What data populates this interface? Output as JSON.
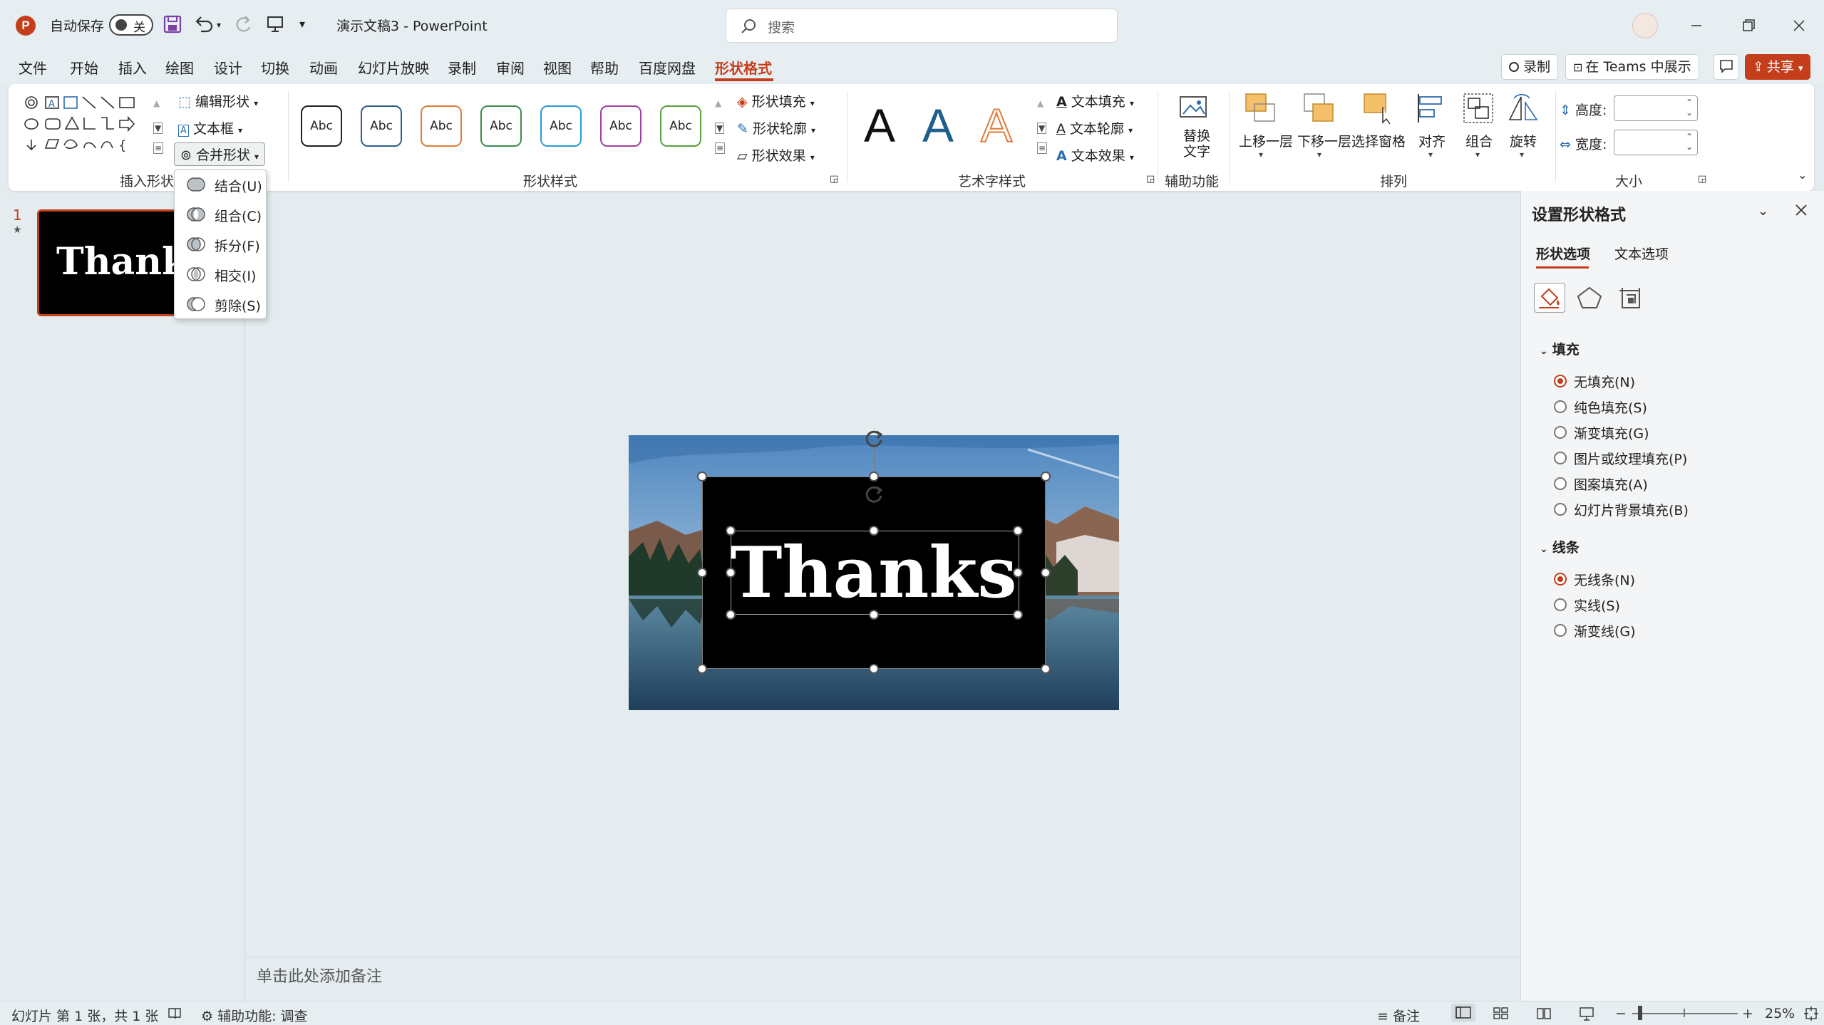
{
  "titlebar": {
    "autosave_label": "自动保存",
    "autosave_state": "关",
    "doc_title": "演示文稿3  -  PowerPoint",
    "search_placeholder": "搜索"
  },
  "menu": {
    "items": [
      "文件",
      "开始",
      "插入",
      "绘图",
      "设计",
      "切换",
      "动画",
      "幻灯片放映",
      "录制",
      "审阅",
      "视图",
      "帮助",
      "百度网盘",
      "形状格式"
    ],
    "active": "形状格式",
    "record_btn": "录制",
    "teams_btn": "在 Teams 中展示",
    "share_btn": "共享"
  },
  "ribbon": {
    "insert_shapes": {
      "label": "插入形状",
      "edit_shape": "编辑形状",
      "text_box": "文本框",
      "merge_shapes": "合并形状"
    },
    "shape_styles": {
      "label": "形状样式",
      "style_sample": "Abc",
      "fill": "形状填充",
      "outline": "形状轮廓",
      "effects": "形状效果"
    },
    "wordart_styles": {
      "label": "艺术字样式",
      "letter": "A",
      "text_fill": "文本填充",
      "text_outline": "文本轮廓",
      "text_effects": "文本效果"
    },
    "accessibility": {
      "label": "辅助功能",
      "alt_text_line1": "替换",
      "alt_text_line2": "文字"
    },
    "arrange": {
      "label": "排列",
      "bring_forward": "上移一层",
      "send_backward": "下移一层",
      "selection_pane": "选择窗格",
      "align": "对齐",
      "group": "组合",
      "rotate": "旋转"
    },
    "size": {
      "label": "大小",
      "height": "高度:",
      "width": "宽度:"
    }
  },
  "merge_menu": {
    "items": [
      "结合(U)",
      "组合(C)",
      "拆分(F)",
      "相交(I)",
      "剪除(S)"
    ]
  },
  "slides": {
    "thumb_number": "1",
    "thumb_star": "★",
    "thumb_text": "Thanks"
  },
  "slide": {
    "text": "Thanks"
  },
  "notes": {
    "placeholder": "单击此处添加备注"
  },
  "panel": {
    "title": "设置形状格式",
    "tabs": [
      "形状选项",
      "文本选项"
    ],
    "fill": {
      "title": "填充",
      "options": [
        "无填充(N)",
        "纯色填充(S)",
        "渐变填充(G)",
        "图片或纹理填充(P)",
        "图案填充(A)",
        "幻灯片背景填充(B)"
      ],
      "selected": "无填充(N)"
    },
    "line": {
      "title": "线条",
      "options": [
        "无线条(N)",
        "实线(S)",
        "渐变线(G)"
      ],
      "selected": "无线条(N)"
    }
  },
  "status": {
    "slide_info": "幻灯片 第 1 张，共 1 张",
    "accessibility": "辅助功能: 调查",
    "notes": "备注",
    "zoom": "25%"
  },
  "colors": {
    "accent": "#c43e1c",
    "style_outlines": [
      "#222222",
      "#2e5f8a",
      "#e07b39",
      "#3c8c4c",
      "#2b9bd3",
      "#a03fa0",
      "#5aa13c"
    ]
  }
}
